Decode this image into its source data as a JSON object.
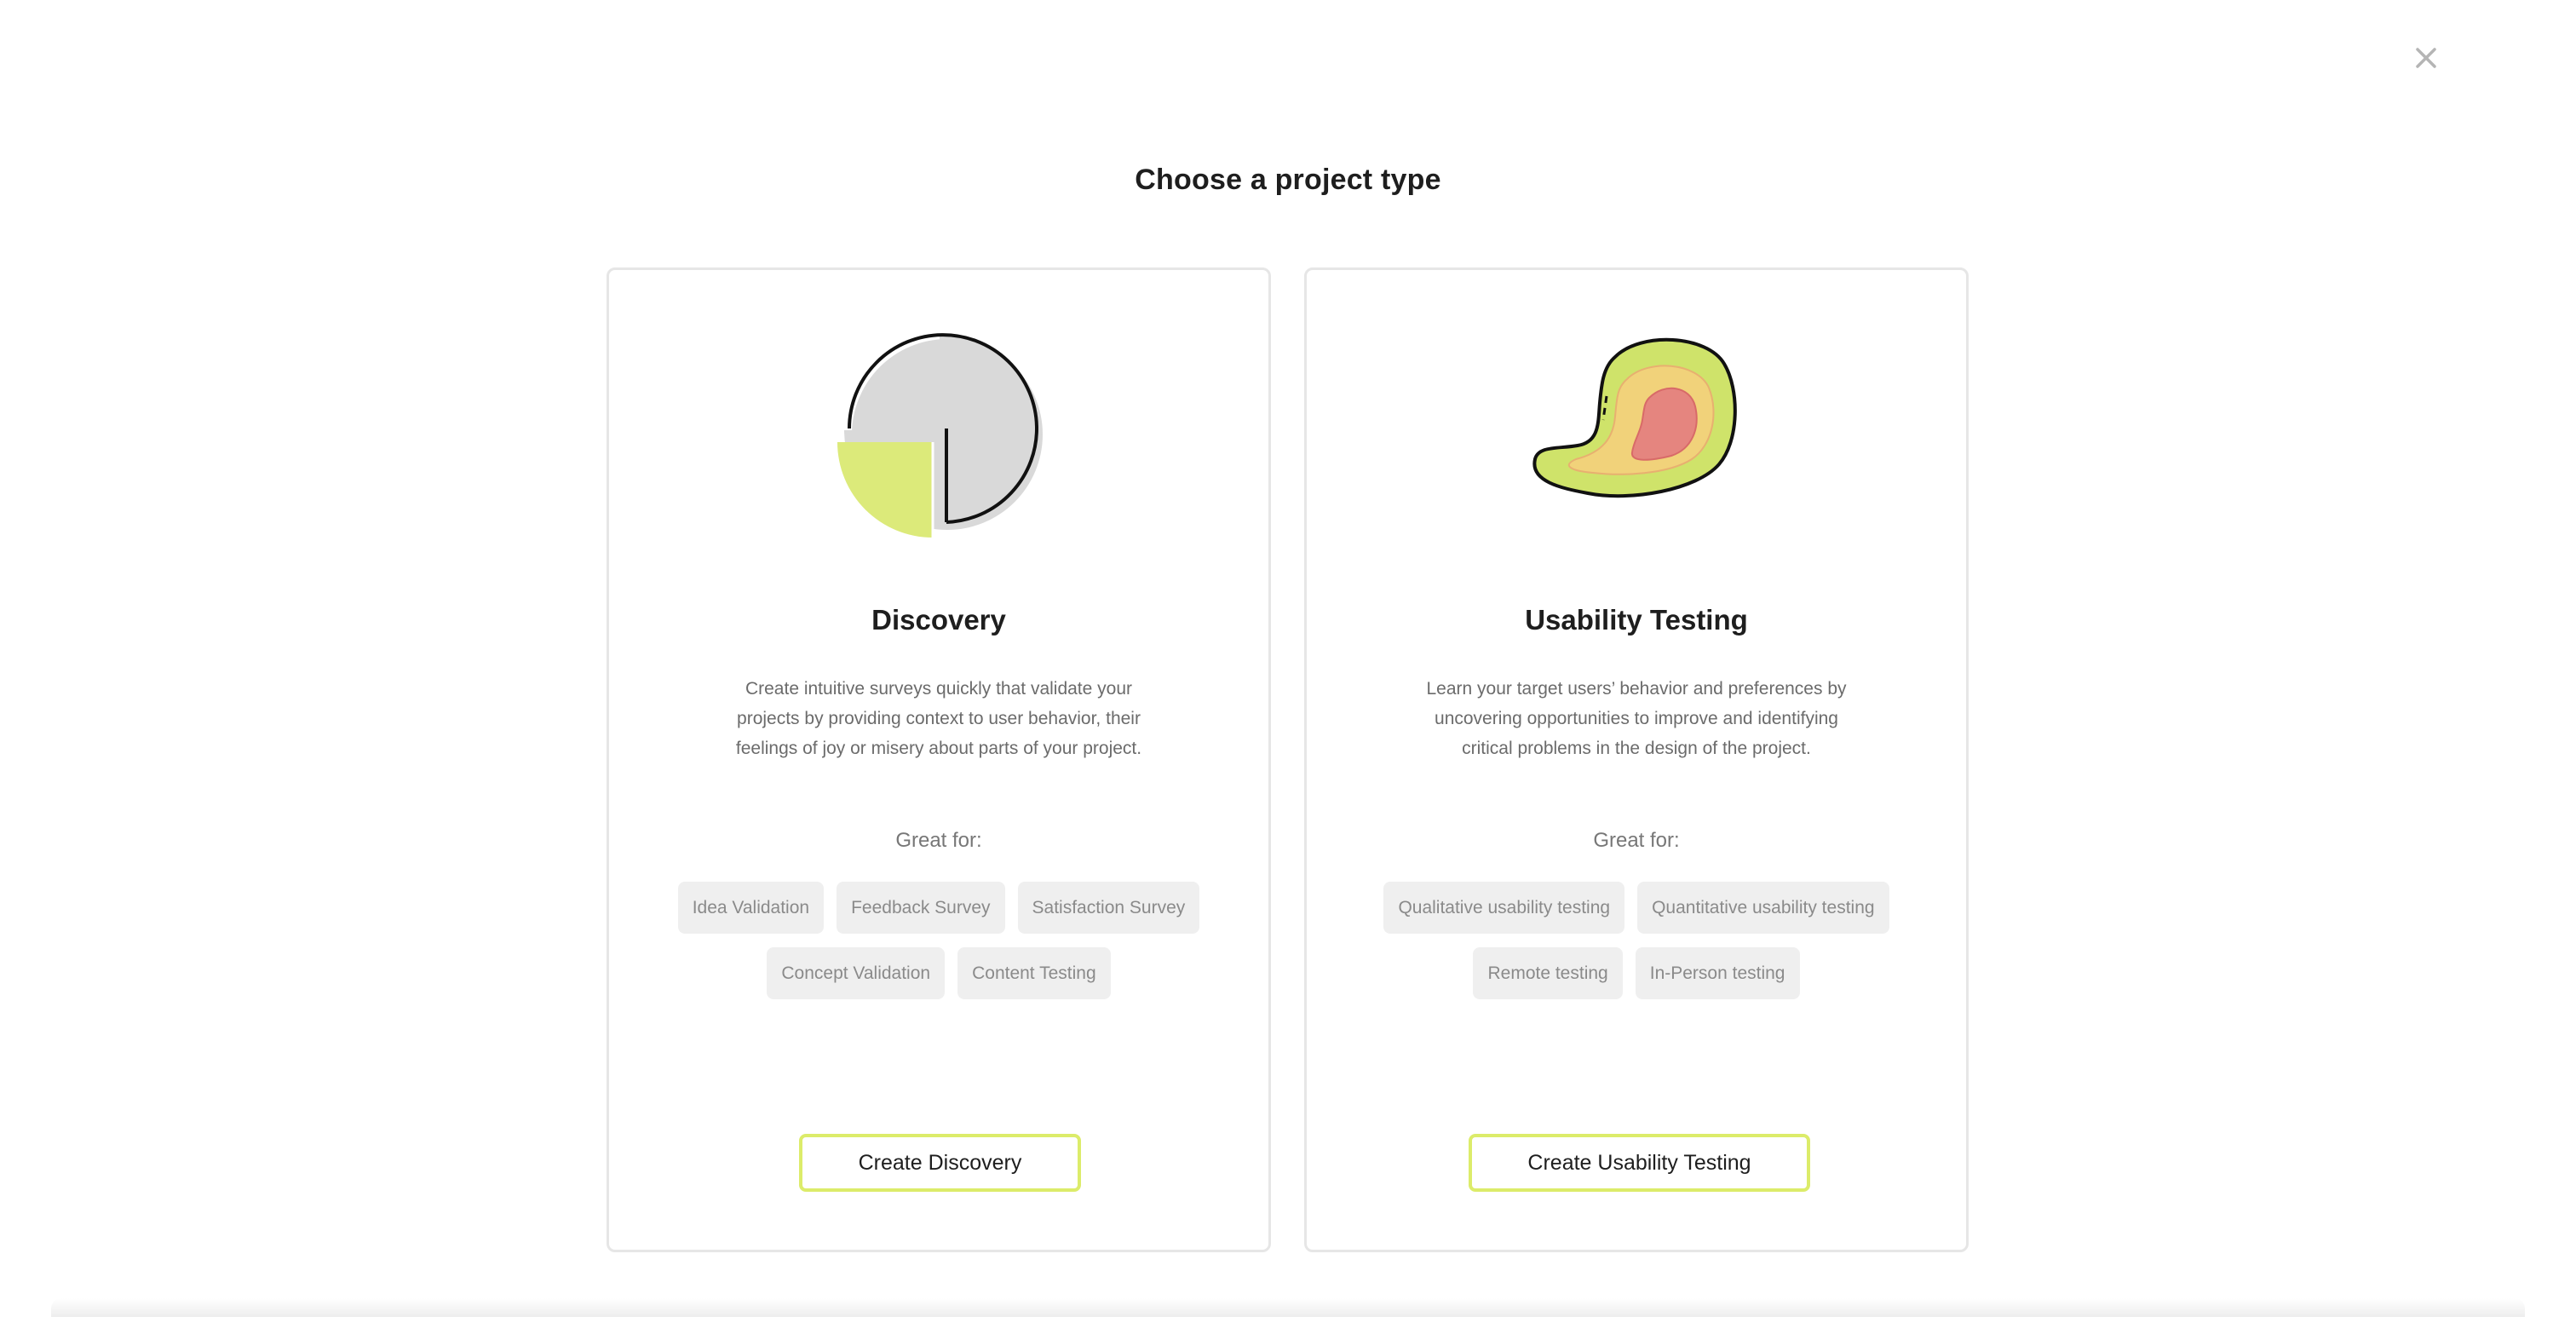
{
  "dialog": {
    "title": "Choose a project type",
    "close_icon": "close-icon"
  },
  "cards": [
    {
      "title": "Discovery",
      "description": "Create intuitive surveys quickly that validate your projects by providing context to user behavior, their feelings of joy or misery about parts of your project.",
      "great_for_label": "Great for:",
      "tags": [
        "Idea Validation",
        "Feedback Survey",
        "Satisfaction Survey",
        "Concept Validation",
        "Content Testing"
      ],
      "button_label": "Create Discovery",
      "icon": "pie-chart-icon"
    },
    {
      "title": "Usability Testing",
      "description": "Learn your target users’ behavior and preferences by uncovering opportunities to improve and identifying critical problems in the design of the project.",
      "great_for_label": "Great for:",
      "tags": [
        "Qualitative usability testing",
        "Quantitative usability testing",
        "Remote testing",
        "In-Person testing"
      ],
      "button_label": "Create Usability Testing",
      "icon": "heatmap-icon"
    }
  ],
  "colors": {
    "accent": "#dcec6a",
    "pie_gray": "#d9d9d9",
    "pie_green": "#dcea7a",
    "heat_green": "#cfe36a",
    "heat_yellow": "#f1d27a",
    "heat_red": "#e5857f",
    "tag_bg": "#efefef",
    "card_border": "#e6e6e6"
  }
}
